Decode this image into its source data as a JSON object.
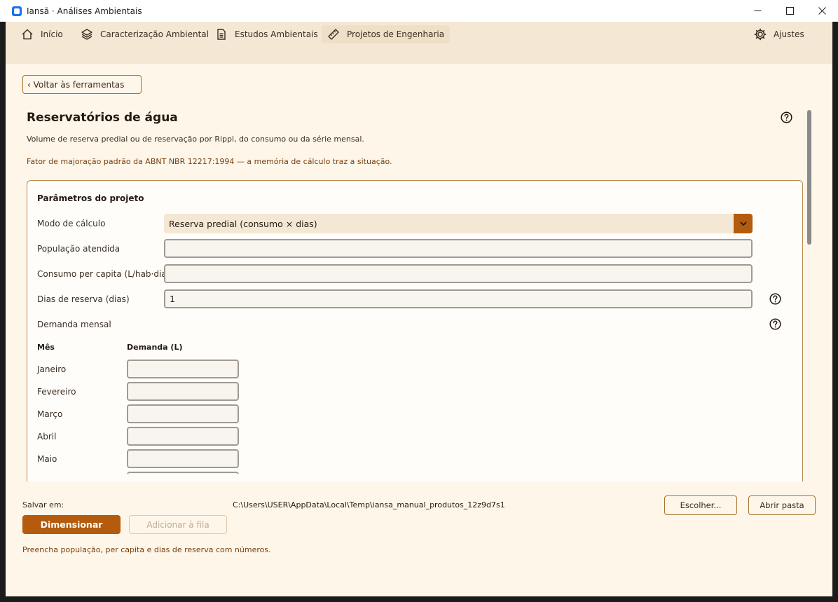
{
  "window": {
    "title": "Iansã · Análises Ambientais"
  },
  "nav": {
    "items": [
      {
        "label": "Início",
        "icon": "home-icon"
      },
      {
        "label": "Caracterização Ambiental",
        "icon": "layers-icon"
      },
      {
        "label": "Estudos Ambientais",
        "icon": "document-icon"
      },
      {
        "label": "Projetos de Engenharia",
        "icon": "ruler-icon",
        "active": true
      }
    ],
    "settings": {
      "label": "Ajustes",
      "icon": "gear-icon"
    }
  },
  "back_button": "‹ Voltar às ferramentas",
  "page": {
    "title": "Reservatórios de água",
    "description": "Volume de reserva predial ou de reservação por Rippl, do consumo ou da série mensal.",
    "note": "Fator de majoração padrão da ABNT NBR 12217:1994 — a memória de cálculo traz a situação."
  },
  "form": {
    "title": "Parâmetros do projeto",
    "mode_label": "Modo de cálculo",
    "mode_value": "Reserva predial (consumo × dias)",
    "population_label": "População atendida",
    "population_value": "",
    "per_capita_label": "Consumo per capita (L/hab·dia)",
    "per_capita_value": "",
    "days_label": "Dias de reserva (dias)",
    "days_value": "1",
    "monthly_label": "Demanda mensal",
    "table_headers": {
      "month": "Mês",
      "demand": "Demanda (L)"
    },
    "months": [
      "Janeiro",
      "Fevereiro",
      "Março",
      "Abril",
      "Maio"
    ]
  },
  "output": {
    "save_label": "Salvar em:",
    "save_path": "C:\\Users\\USER\\AppData\\Local\\Temp\\iansa_manual_produtos_12z9d7s1",
    "choose_button": "Escolher...",
    "open_folder_button": "Abrir pasta"
  },
  "actions": {
    "primary": "Dimensionar",
    "queue": "Adicionar à fila"
  },
  "status": "Preencha população, per capita e dias de reserva com números.",
  "colors": {
    "accent": "#b45b0d",
    "background": "#fdf6e9",
    "nav_bg": "#f4e8d5",
    "warning_text": "#7a3e0c"
  }
}
